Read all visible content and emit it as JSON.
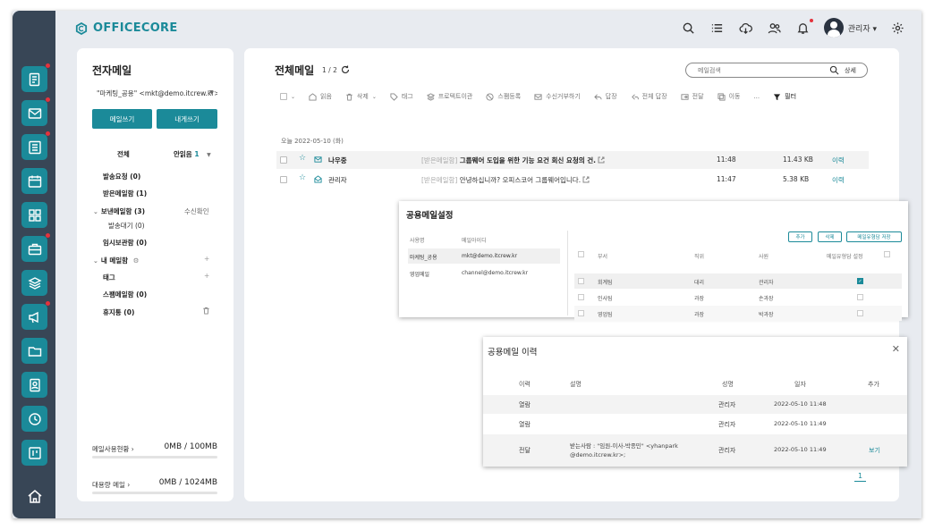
{
  "brand": {
    "name": "OFFICECORE",
    "color": "#1b8a99"
  },
  "sidebar": {
    "icons": [
      {
        "name": "approval-doc-icon",
        "dot": true
      },
      {
        "name": "mail-icon",
        "dot": true
      },
      {
        "name": "board-icon",
        "dot": true
      },
      {
        "name": "calendar-icon",
        "dot": false
      },
      {
        "name": "apps-grid-icon",
        "dot": false
      },
      {
        "name": "briefcase-icon",
        "dot": true
      },
      {
        "name": "layers-icon",
        "dot": false
      },
      {
        "name": "megaphone-icon",
        "dot": true
      },
      {
        "name": "folder-icon",
        "dot": false
      },
      {
        "name": "address-book-icon",
        "dot": false
      },
      {
        "name": "clock-icon",
        "dot": false
      },
      {
        "name": "kanban-icon",
        "dot": false
      }
    ],
    "home": "home-icon"
  },
  "topbar": {
    "user_name": "관리자 ▾"
  },
  "left_panel": {
    "title": "전자메일",
    "account_select": "\"마케팅_공용\" <mkt@demo.itcrew.kr>",
    "write_button": "메일쓰기",
    "self_write_button": "내게쓰기",
    "filter_all": "전체",
    "filter_unread": "안읽음",
    "unread_count": "1",
    "folders": {
      "send_request": "발송요청 (0)",
      "inbox": "받은메일함 (1)",
      "sent": "보낸메일함 (3)",
      "receipt_check": "수신확인",
      "sent_pending": "발송대기 (0)",
      "drafts": "임시보관함 (0)",
      "my_folders": "내 메일함",
      "tags": "태그",
      "spam": "스팸메일함 (0)",
      "trash": "휴지통 (0)"
    },
    "storage": {
      "mail_usage_label": "메일사용현황",
      "mail_usage_value": "0MB / 100MB",
      "mail_usage_fraction": 0.0,
      "large_mail_label": "대용량 메일",
      "large_mail_value": "0MB / 1024MB",
      "large_mail_fraction": 0.0
    }
  },
  "main": {
    "title": "전체메일",
    "page": "1 / 2",
    "search_placeholder": "메일검색",
    "search_detail": "상세",
    "toolbar": {
      "read": "읽음",
      "delete": "삭제",
      "tag": "태그",
      "protect": "프로텍트이관",
      "spam": "스팸등록",
      "reject": "수신거부하기",
      "reply": "답장",
      "reply_all": "전체 답장",
      "forward": "전달",
      "move": "이동",
      "more": "...",
      "filter": "필터"
    },
    "date_group": "오늘 2022-05-10 (화)",
    "mails": [
      {
        "sender": "나우중",
        "tag": "[받은메일함]",
        "subject": "그룹웨어 도입을 위한 기능 요건 회신 요청의 건.",
        "time": "11:48",
        "size": "11.43 KB",
        "history": "이력",
        "bold": true
      },
      {
        "sender": "관리자",
        "tag": "[받은메일함]",
        "subject": "안녕하십니까? 오피스코어 그룹웨어입니다.",
        "time": "11:47",
        "size": "5.38 KB",
        "history": "이력",
        "bold": false
      }
    ],
    "pager": "1"
  },
  "shared_setting": {
    "title": "공용메일설정",
    "left_headers": {
      "name": "사용명",
      "mail": "메일아이디"
    },
    "left_rows": [
      {
        "name": "마케팅_공용",
        "mail": "mkt@demo.itcrew.kr"
      },
      {
        "name": "영업메일",
        "mail": "channel@demo.itcrew.kr"
      }
    ],
    "buttons": {
      "add": "추가",
      "delete": "삭제",
      "save": "메일유형담 저장"
    },
    "headers": {
      "dept": "부서",
      "rank": "직위",
      "name": "사원",
      "manager": "메일유형담 설정"
    },
    "rows": [
      {
        "dept": "회계팀",
        "rank": "대리",
        "name": "관리자",
        "checked": true
      },
      {
        "dept": "인사팀",
        "rank": "과장",
        "name": "손과장",
        "checked": false
      },
      {
        "dept": "영업팀",
        "rank": "과장",
        "name": "박과장",
        "checked": false
      }
    ]
  },
  "shared_history": {
    "title": "공용메일 이력",
    "headers": {
      "history": "이력",
      "desc": "설명",
      "name": "성명",
      "date": "일자",
      "add": "추가"
    },
    "rows": [
      {
        "history": "열람",
        "desc": "",
        "desc2": "",
        "name": "관리자",
        "date": "2022-05-10 11:48",
        "add": ""
      },
      {
        "history": "열람",
        "desc": "",
        "desc2": "",
        "name": "관리자",
        "date": "2022-05-10 11:49",
        "add": ""
      },
      {
        "history": "전달",
        "desc": "받는사람 : \"임원-이사-박종민\" <yhanpark",
        "desc2": "@demo.itcrew.kr>;",
        "name": "관리자",
        "date": "2022-05-10 11:49",
        "add": "보기"
      }
    ]
  }
}
